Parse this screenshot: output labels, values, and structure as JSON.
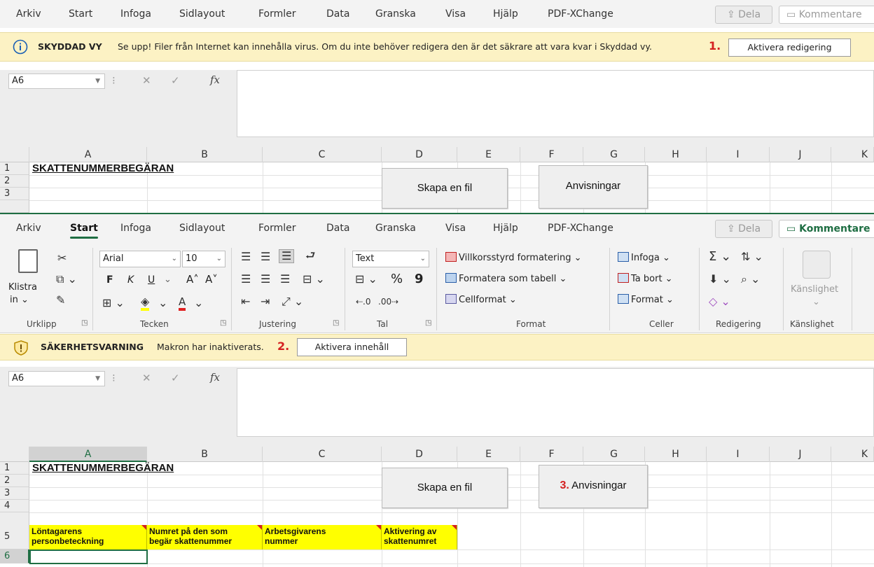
{
  "top": {
    "menu": [
      "Arkiv",
      "Start",
      "Infoga",
      "Sidlayout",
      "Formler",
      "Data",
      "Granska",
      "Visa",
      "Hjälp",
      "PDF-XChange"
    ],
    "share_label": "Dela",
    "comment_label": "Kommentare",
    "msg": {
      "title": "SKYDDAD VY",
      "text": "Se upp! Filer från Internet kan innehålla virus. Om du inte behöver redigera den är det säkrare att vara kvar i Skyddad vy.",
      "step": "1.",
      "button": "Aktivera redigering"
    },
    "name_box": "A6",
    "columns": [
      "A",
      "B",
      "C",
      "D",
      "E",
      "F",
      "G",
      "H",
      "I",
      "J",
      "K"
    ],
    "rows": [
      "1",
      "2",
      "3"
    ],
    "title_cell": "SKATTENUMMERBEGÄRAN",
    "button_create": "Skapa en fil",
    "button_instructions": "Anvisningar"
  },
  "bottom": {
    "menu": [
      "Arkiv",
      "Start",
      "Infoga",
      "Sidlayout",
      "Formler",
      "Data",
      "Granska",
      "Visa",
      "Hjälp",
      "PDF-XChange"
    ],
    "active_tab": "Start",
    "share_label": "Dela",
    "comment_label": "Kommentare",
    "ribbon": {
      "clipboard": {
        "paste": "Klistra",
        "paste2": "in",
        "label": "Urklipp"
      },
      "font": {
        "name": "Arial",
        "size": "10",
        "bold": "F",
        "italic": "K",
        "underline": "U",
        "grow": "A˄",
        "shrink": "A˅",
        "label": "Tecken"
      },
      "align": {
        "label": "Justering"
      },
      "number": {
        "format": "Text",
        "percent": "%",
        "comma": "9",
        "label": "Tal"
      },
      "styles": {
        "cond": "Villkorsstyrd formatering",
        "table": "Formatera som tabell",
        "cell": "Cellformat",
        "label": "Format"
      },
      "cells": {
        "insert": "Infoga",
        "delete": "Ta bort",
        "format": "Format",
        "label": "Celler"
      },
      "editing": {
        "label": "Redigering"
      },
      "sensitivity": {
        "btn": "Känslighet",
        "label": "Känslighet"
      }
    },
    "msg": {
      "title": "SÄKERHETSVARNING",
      "text": "Makron har inaktiverats.",
      "step": "2.",
      "button": "Aktivera innehåll"
    },
    "name_box": "A6",
    "columns": [
      "A",
      "B",
      "C",
      "D",
      "E",
      "F",
      "G",
      "H",
      "I",
      "J",
      "K"
    ],
    "rows": [
      "1",
      "2",
      "3",
      "4",
      "5",
      "6"
    ],
    "title_cell": "SKATTENUMMERBEGÄRAN",
    "button_create": "Skapa en fil",
    "button_instructions": "Anvisningar",
    "instructions_step": "3.",
    "headers": [
      {
        "line1": "Löntagarens",
        "line2": "personbeteckning"
      },
      {
        "line1": "Numret på den som",
        "line2": "begär skattenummer"
      },
      {
        "line1": "Arbetsgivarens",
        "line2": "nummer"
      },
      {
        "line1": "Aktivering av",
        "line2": "skattenumret"
      }
    ]
  },
  "colors": {
    "accent": "#1f6e43",
    "warning_bg": "#fcf2c4",
    "header_yellow": "#ffff00",
    "step_red": "#d42020"
  }
}
